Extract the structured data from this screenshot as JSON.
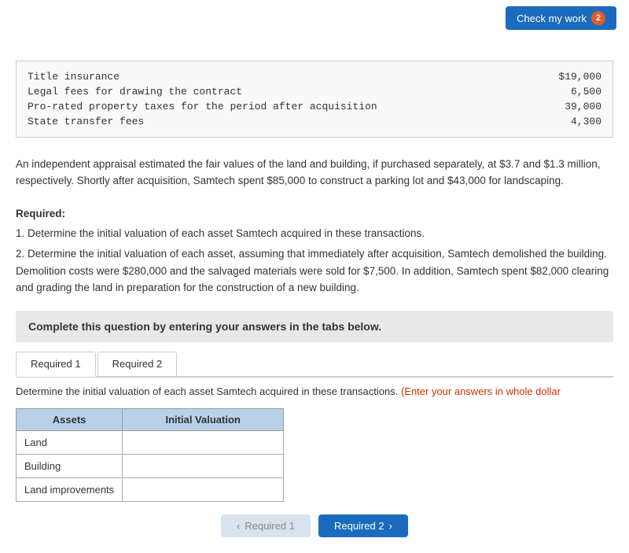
{
  "topBar": {
    "checkMyWorkLabel": "Check my work",
    "checkBadge": "2"
  },
  "truncatedText": "...",
  "feeTable": {
    "rows": [
      {
        "label": "Title insurance",
        "value": "$19,000"
      },
      {
        "label": "Legal fees for drawing the contract",
        "value": "6,500"
      },
      {
        "label": "Pro-rated property taxes for the period after acquisition",
        "value": "39,000"
      },
      {
        "label": "State transfer fees",
        "value": "4,300"
      }
    ]
  },
  "description": "An independent appraisal estimated the fair values of the land and building, if purchased separately, at $3.7 and $1.3 million, respectively. Shortly after acquisition, Samtech spent $85,000 to construct a parking lot and $43,000 for landscaping.",
  "requiredSection": {
    "header": "Required:",
    "item1": "1. Determine the initial valuation of each asset Samtech acquired in these transactions.",
    "item2": "2. Determine the initial valuation of each asset, assuming that immediately after acquisition, Samtech demolished the building. Demolition costs were $280,000 and the salvaged materials were sold for $7,500. In addition, Samtech spent $82,000 clearing and grading the land in preparation for the construction of a new building."
  },
  "completeBox": {
    "text": "Complete this question by entering your answers in the tabs below."
  },
  "tabs": [
    {
      "label": "Required 1",
      "active": true
    },
    {
      "label": "Required 2",
      "active": false
    }
  ],
  "determineText": {
    "main": "Determine the initial valuation of each asset Samtech acquired in these transactions. ",
    "highlight": "(Enter your answers in whole dollar"
  },
  "assetsTable": {
    "headers": [
      "Assets",
      "Initial Valuation"
    ],
    "rows": [
      {
        "asset": "Land",
        "value": ""
      },
      {
        "asset": "Building",
        "value": ""
      },
      {
        "asset": "Land improvements",
        "value": ""
      }
    ]
  },
  "navButtons": {
    "prevLabel": "Required 1",
    "nextLabel": "Required 2"
  }
}
